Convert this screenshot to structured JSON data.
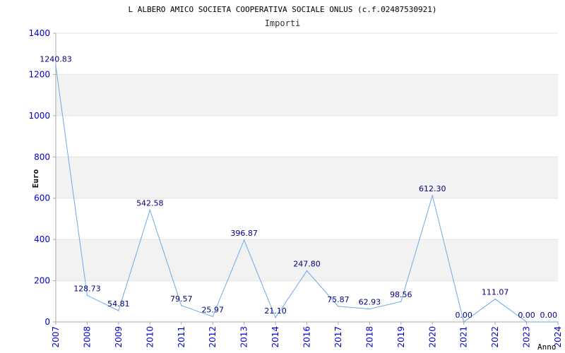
{
  "chart_data": {
    "type": "line",
    "title": "L ALBERO AMICO SOCIETA COOPERATIVA SOCIALE ONLUS (c.f.02487530921)",
    "subtitle": "Importi",
    "xlabel": "Anno",
    "ylabel": "Euro",
    "ylim": [
      0,
      1400
    ],
    "yticks": [
      0,
      200,
      400,
      600,
      800,
      1000,
      1200,
      1400
    ],
    "grid": "horizontal bands",
    "x": [
      "2007",
      "2008",
      "2009",
      "2010",
      "2011",
      "2012",
      "2013",
      "2014",
      "2016",
      "2017",
      "2018",
      "2019",
      "2020",
      "2021",
      "2022",
      "2023",
      "2024"
    ],
    "series": [
      {
        "values": [
          1240.83,
          128.73,
          54.81,
          542.58,
          79.57,
          25.97,
          396.87,
          21.1,
          247.8,
          75.87,
          62.93,
          98.56,
          612.3,
          0.0,
          111.07,
          0.0,
          0.0
        ],
        "labels": [
          "1240.83",
          "128.73",
          "54.81",
          "542.58",
          "79.57",
          "25.97",
          "396.87",
          "21.10",
          "247.80",
          "75.87",
          "62.93",
          "98.56",
          "612.30",
          "0.00",
          "111.07",
          "0.00",
          "0.00"
        ]
      }
    ],
    "colors": {
      "line": "#6aaaee",
      "band": "#f2f2f2",
      "axis": "#aaaaaa",
      "tick_text": "#0000cc",
      "data_label": "#000080"
    }
  }
}
